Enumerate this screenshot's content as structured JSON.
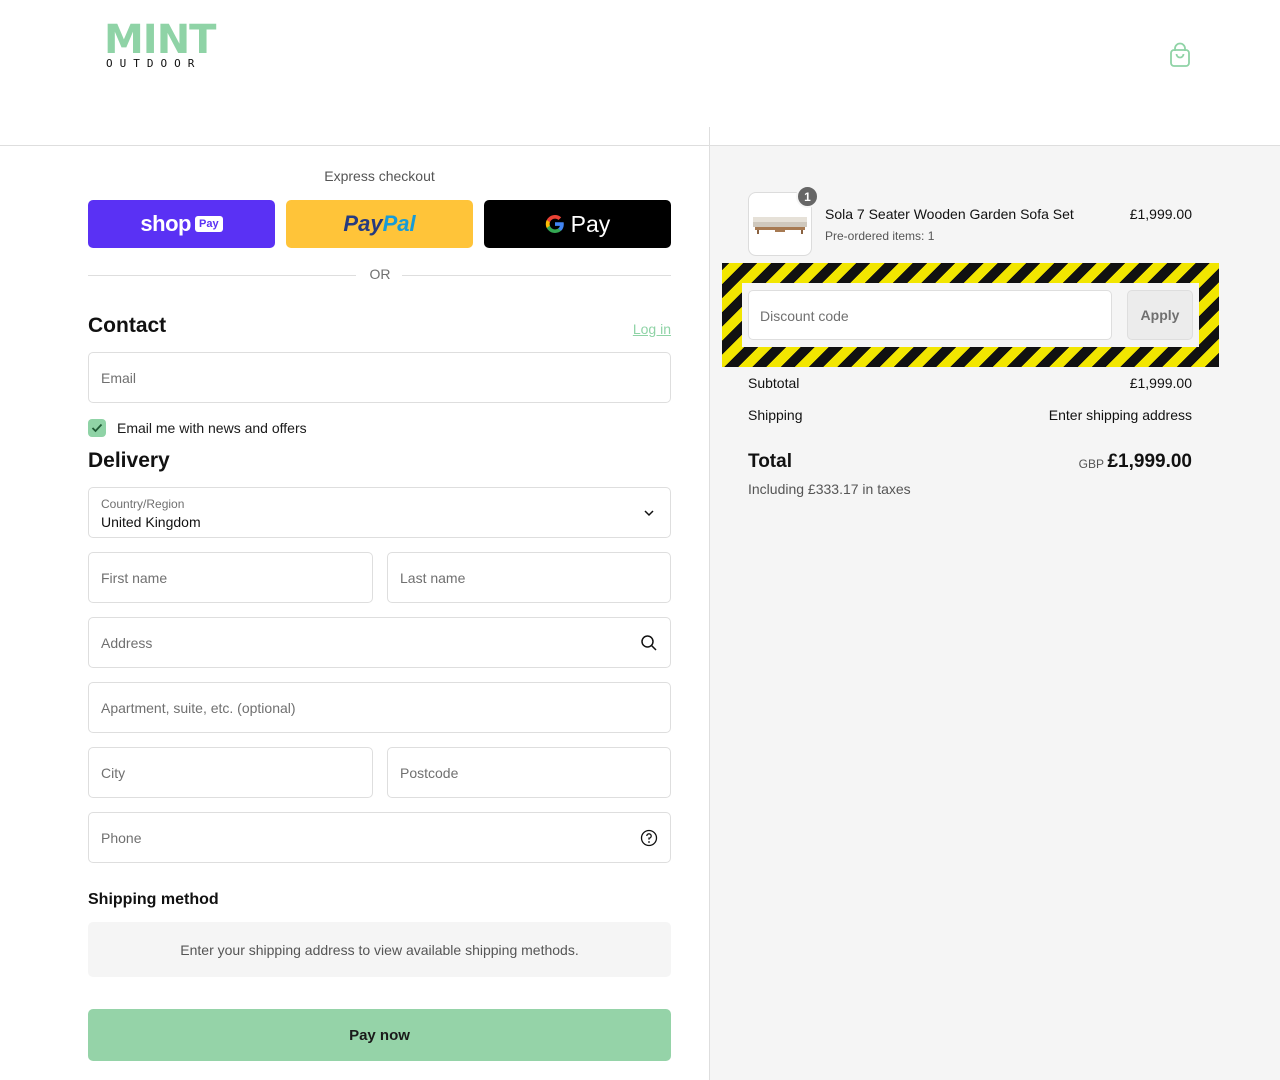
{
  "brand": {
    "name": "MINT",
    "tagline": "OUTDOOR",
    "accent": "#8fd3a6"
  },
  "express": {
    "title": "Express checkout",
    "shop_pay_text": "shop",
    "shop_pay_badge": "Pay",
    "paypal_part1": "Pay",
    "paypal_part2": "Pal",
    "gpay_text": "Pay",
    "or": "OR"
  },
  "contact": {
    "heading": "Contact",
    "login": "Log in",
    "email_placeholder": "Email",
    "news_checkbox_label": "Email me with news and offers",
    "news_checked": true
  },
  "delivery": {
    "heading": "Delivery",
    "country_label": "Country/Region",
    "country_value": "United Kingdom",
    "first_name": "First name",
    "last_name": "Last name",
    "address": "Address",
    "apartment": "Apartment, suite, etc. (optional)",
    "city": "City",
    "postcode": "Postcode",
    "phone": "Phone"
  },
  "shipping_method": {
    "heading": "Shipping method",
    "info": "Enter your shipping address to view available shipping methods."
  },
  "pay_now": "Pay now",
  "summary": {
    "item": {
      "name": "Sola 7 Seater Wooden Garden Sofa Set",
      "note": "Pre-ordered items: 1",
      "price": "£1,999.00",
      "quantity": "1"
    },
    "discount_placeholder": "Discount code",
    "apply": "Apply",
    "subtotal_label": "Subtotal",
    "subtotal_value": "£1,999.00",
    "shipping_label": "Shipping",
    "shipping_value": "Enter shipping address",
    "total_label": "Total",
    "currency": "GBP",
    "total_value": "£1,999.00",
    "tax_note": "Including £333.17 in taxes"
  }
}
